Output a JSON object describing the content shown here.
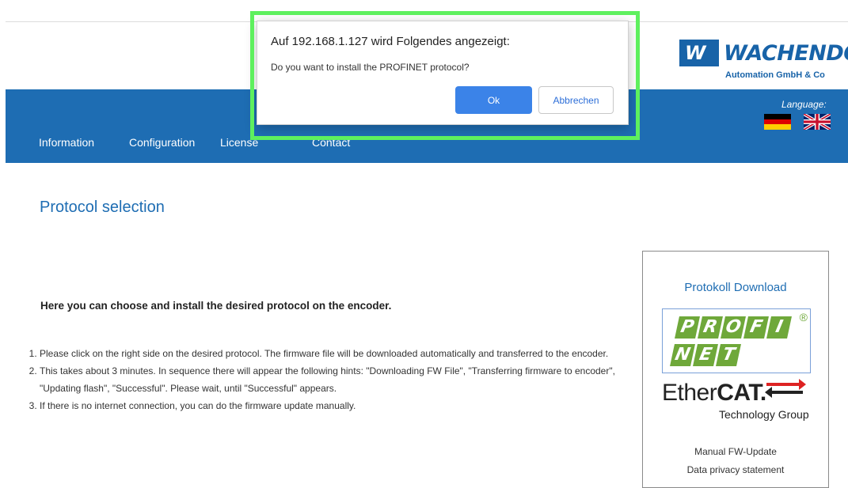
{
  "header": {
    "logo_mark": "W",
    "logo_name": "WACHENDOR",
    "logo_sub": "Automation GmbH & Co"
  },
  "nav": {
    "items": [
      "Information",
      "Configuration",
      "License",
      "Contact"
    ],
    "language_label": "Language:"
  },
  "main": {
    "title": "Protocol selection",
    "intro": "Here you can choose and install the desired protocol on the encoder.",
    "steps": [
      "Please click on the right side on the desired protocol. The firmware file will be downloaded automatically and transferred to the encoder.",
      "This takes about 3 minutes. In sequence there will appear the following hints: \"Downloading FW File\", \"Transferring firmware to encoder\", \"Updating flash\", \"Successful\". Please wait, until \"Successful\" appears.",
      "If there is no internet connection, you can do the firmware update manually."
    ]
  },
  "download": {
    "title": "Protokoll Download",
    "profinet_row1": [
      "P",
      "R",
      "O",
      "F",
      "I"
    ],
    "profinet_row2": [
      "N",
      "E",
      "T"
    ],
    "registered": "®",
    "ethercat_prefix": "Ether",
    "ethercat_bold": "CAT.",
    "ethercat_sub": "Technology Group",
    "manual_update": "Manual FW-Update",
    "privacy": "Data privacy statement"
  },
  "dialog": {
    "title": "Auf 192.168.1.127 wird Folgendes angezeigt:",
    "message": "Do you want to install the PROFINET protocol?",
    "ok_label": "Ok",
    "cancel_label": "Abbrechen"
  },
  "colors": {
    "nav_bg": "#1e6db3",
    "accent": "#1e6db3",
    "ok_button": "#3b83e8",
    "highlight": "#5ef05e",
    "profinet_green": "#6fa83a"
  }
}
